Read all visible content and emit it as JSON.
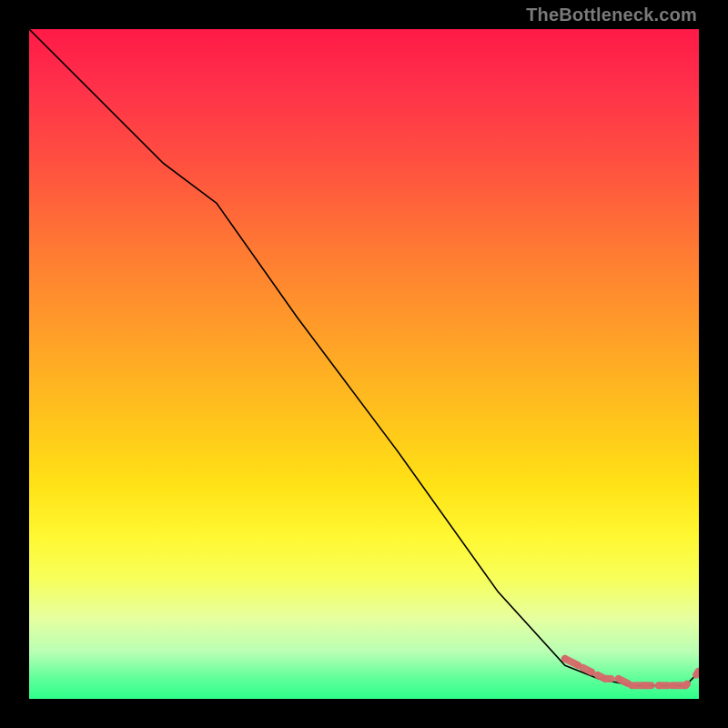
{
  "watermark": "TheBottleneck.com",
  "chart_data": {
    "type": "line",
    "title": "",
    "xlabel": "",
    "ylabel": "",
    "xlim": [
      0,
      100
    ],
    "ylim": [
      0,
      100
    ],
    "grid": false,
    "legend": false,
    "series": [
      {
        "name": "bottleneck-curve",
        "x": [
          0,
          10,
          20,
          28,
          40,
          55,
          70,
          80,
          85,
          90,
          95,
          98,
          100
        ],
        "y": [
          100,
          90,
          80,
          74,
          57,
          37,
          16,
          5,
          3,
          2,
          2,
          2,
          4
        ]
      }
    ],
    "highlight": {
      "name": "bottom-cluster",
      "x": [
        80,
        82,
        84,
        86,
        88,
        90,
        92,
        94,
        96,
        98,
        100
      ],
      "y": [
        6,
        5,
        4,
        3,
        3,
        2,
        2,
        2,
        2,
        2,
        4
      ]
    }
  }
}
